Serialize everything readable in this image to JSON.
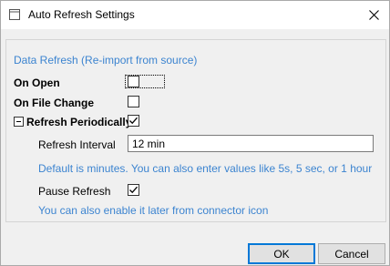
{
  "window": {
    "title": "Auto Refresh Settings",
    "app_icon": "app-window-icon",
    "close_icon": "close-icon"
  },
  "section": {
    "title": "Data Refresh (Re-import from source)"
  },
  "options": {
    "on_open": {
      "label": "On Open",
      "checked": false
    },
    "on_file_change": {
      "label": "On File Change",
      "checked": false
    },
    "refresh_periodically": {
      "label": "Refresh Periodically",
      "checked": true,
      "expanded": true
    },
    "refresh_interval": {
      "label": "Refresh Interval",
      "value": "12 min"
    },
    "interval_hint": "Default is minutes. You can also enter values like 5s, 5 sec, or 1 hour",
    "pause_refresh": {
      "label": "Pause Refresh",
      "checked": true
    },
    "pause_hint": "You can also enable it later from connector icon"
  },
  "buttons": {
    "ok": "OK",
    "cancel": "Cancel"
  },
  "colors": {
    "hint": "#3c84d0",
    "focus_border": "#0078d7"
  }
}
